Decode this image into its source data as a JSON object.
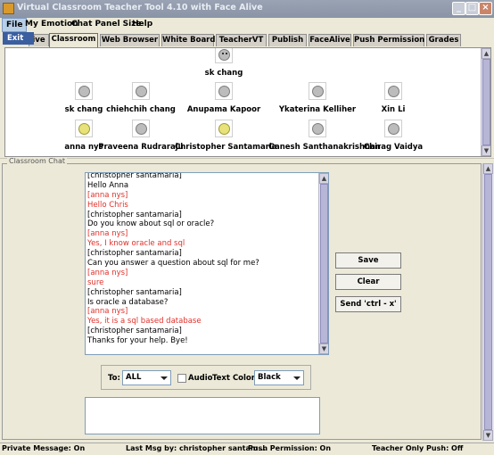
{
  "window": {
    "title": "Virtual Classroom Teacher Tool 4.10 with Face Alive"
  },
  "menu": {
    "items": [
      "File",
      "My Emotion",
      "Chat Panel Size",
      "Help"
    ],
    "open_dropdown": "Exit"
  },
  "tabs": [
    "ive",
    "Classroom",
    "Web Browser",
    "White Board",
    "TeacherVT",
    "Publish",
    "FaceAlive",
    "Push Permission",
    "Grades"
  ],
  "roster": {
    "teacher": "sk chang",
    "students": [
      {
        "name": "sk chang",
        "face": "gray-smiley-icon"
      },
      {
        "name": "chiehchih chang",
        "face": "gray-smiley-icon"
      },
      {
        "name": "Anupama Kapoor",
        "face": "gray-smiley-icon"
      },
      {
        "name": "Ykaterina Kelliher",
        "face": "gray-smiley-icon"
      },
      {
        "name": "Xin Li",
        "face": "gray-smiley-icon"
      },
      {
        "name": "anna nys",
        "face": "yellow-smiley-icon"
      },
      {
        "name": "Praveena Rudraraju",
        "face": "gray-smiley-icon"
      },
      {
        "name": "Christopher Santamaria",
        "face": "yellow-smiley-icon"
      },
      {
        "name": "Ganesh Santhanakrishnan",
        "face": "gray-smiley-icon"
      },
      {
        "name": "Chirag Vaidya",
        "face": "gray-smiley-icon"
      }
    ]
  },
  "chat": {
    "panel_label": "Classroom Chat",
    "lines": [
      {
        "text": "[christopher santamaria]",
        "color": "black"
      },
      {
        "text": "Hello Anna",
        "color": "black"
      },
      {
        "text": "[anna nys]",
        "color": "red"
      },
      {
        "text": "Hello Chris",
        "color": "red"
      },
      {
        "text": "[christopher santamaria]",
        "color": "black"
      },
      {
        "text": "Do you know about sql or oracle?",
        "color": "black"
      },
      {
        "text": "[anna nys]",
        "color": "red"
      },
      {
        "text": "Yes, I know oracle and sql",
        "color": "red"
      },
      {
        "text": "[christopher santamaria]",
        "color": "black"
      },
      {
        "text": "Can you answer a question about sql for me?",
        "color": "black"
      },
      {
        "text": "[anna nys]",
        "color": "red"
      },
      {
        "text": "sure",
        "color": "red"
      },
      {
        "text": "[christopher santamaria]",
        "color": "black"
      },
      {
        "text": "Is oracle a database?",
        "color": "black"
      },
      {
        "text": "[anna nys]",
        "color": "red"
      },
      {
        "text": "Yes, it is a sql based database",
        "color": "red"
      },
      {
        "text": "[christopher santamaria]",
        "color": "black"
      },
      {
        "text": "Thanks for your help. Bye!",
        "color": "black"
      }
    ],
    "buttons": {
      "save": "Save",
      "clear": "Clear",
      "send": "Send 'ctrl - x'"
    },
    "to_label": "To:",
    "to_value": "ALL",
    "audio_label": "Audio",
    "text_color_label": "Text Color:",
    "text_color_value": "Black"
  },
  "status": {
    "private": "Private Message: On",
    "last_msg": "Last Msg by: christopher santam...",
    "push": "Push Permission: On",
    "teacher_push": "Teacher Only Push: Off"
  },
  "colors": {
    "red_text": "#e0302a",
    "scroll_thumb": "#b8b6d6"
  }
}
